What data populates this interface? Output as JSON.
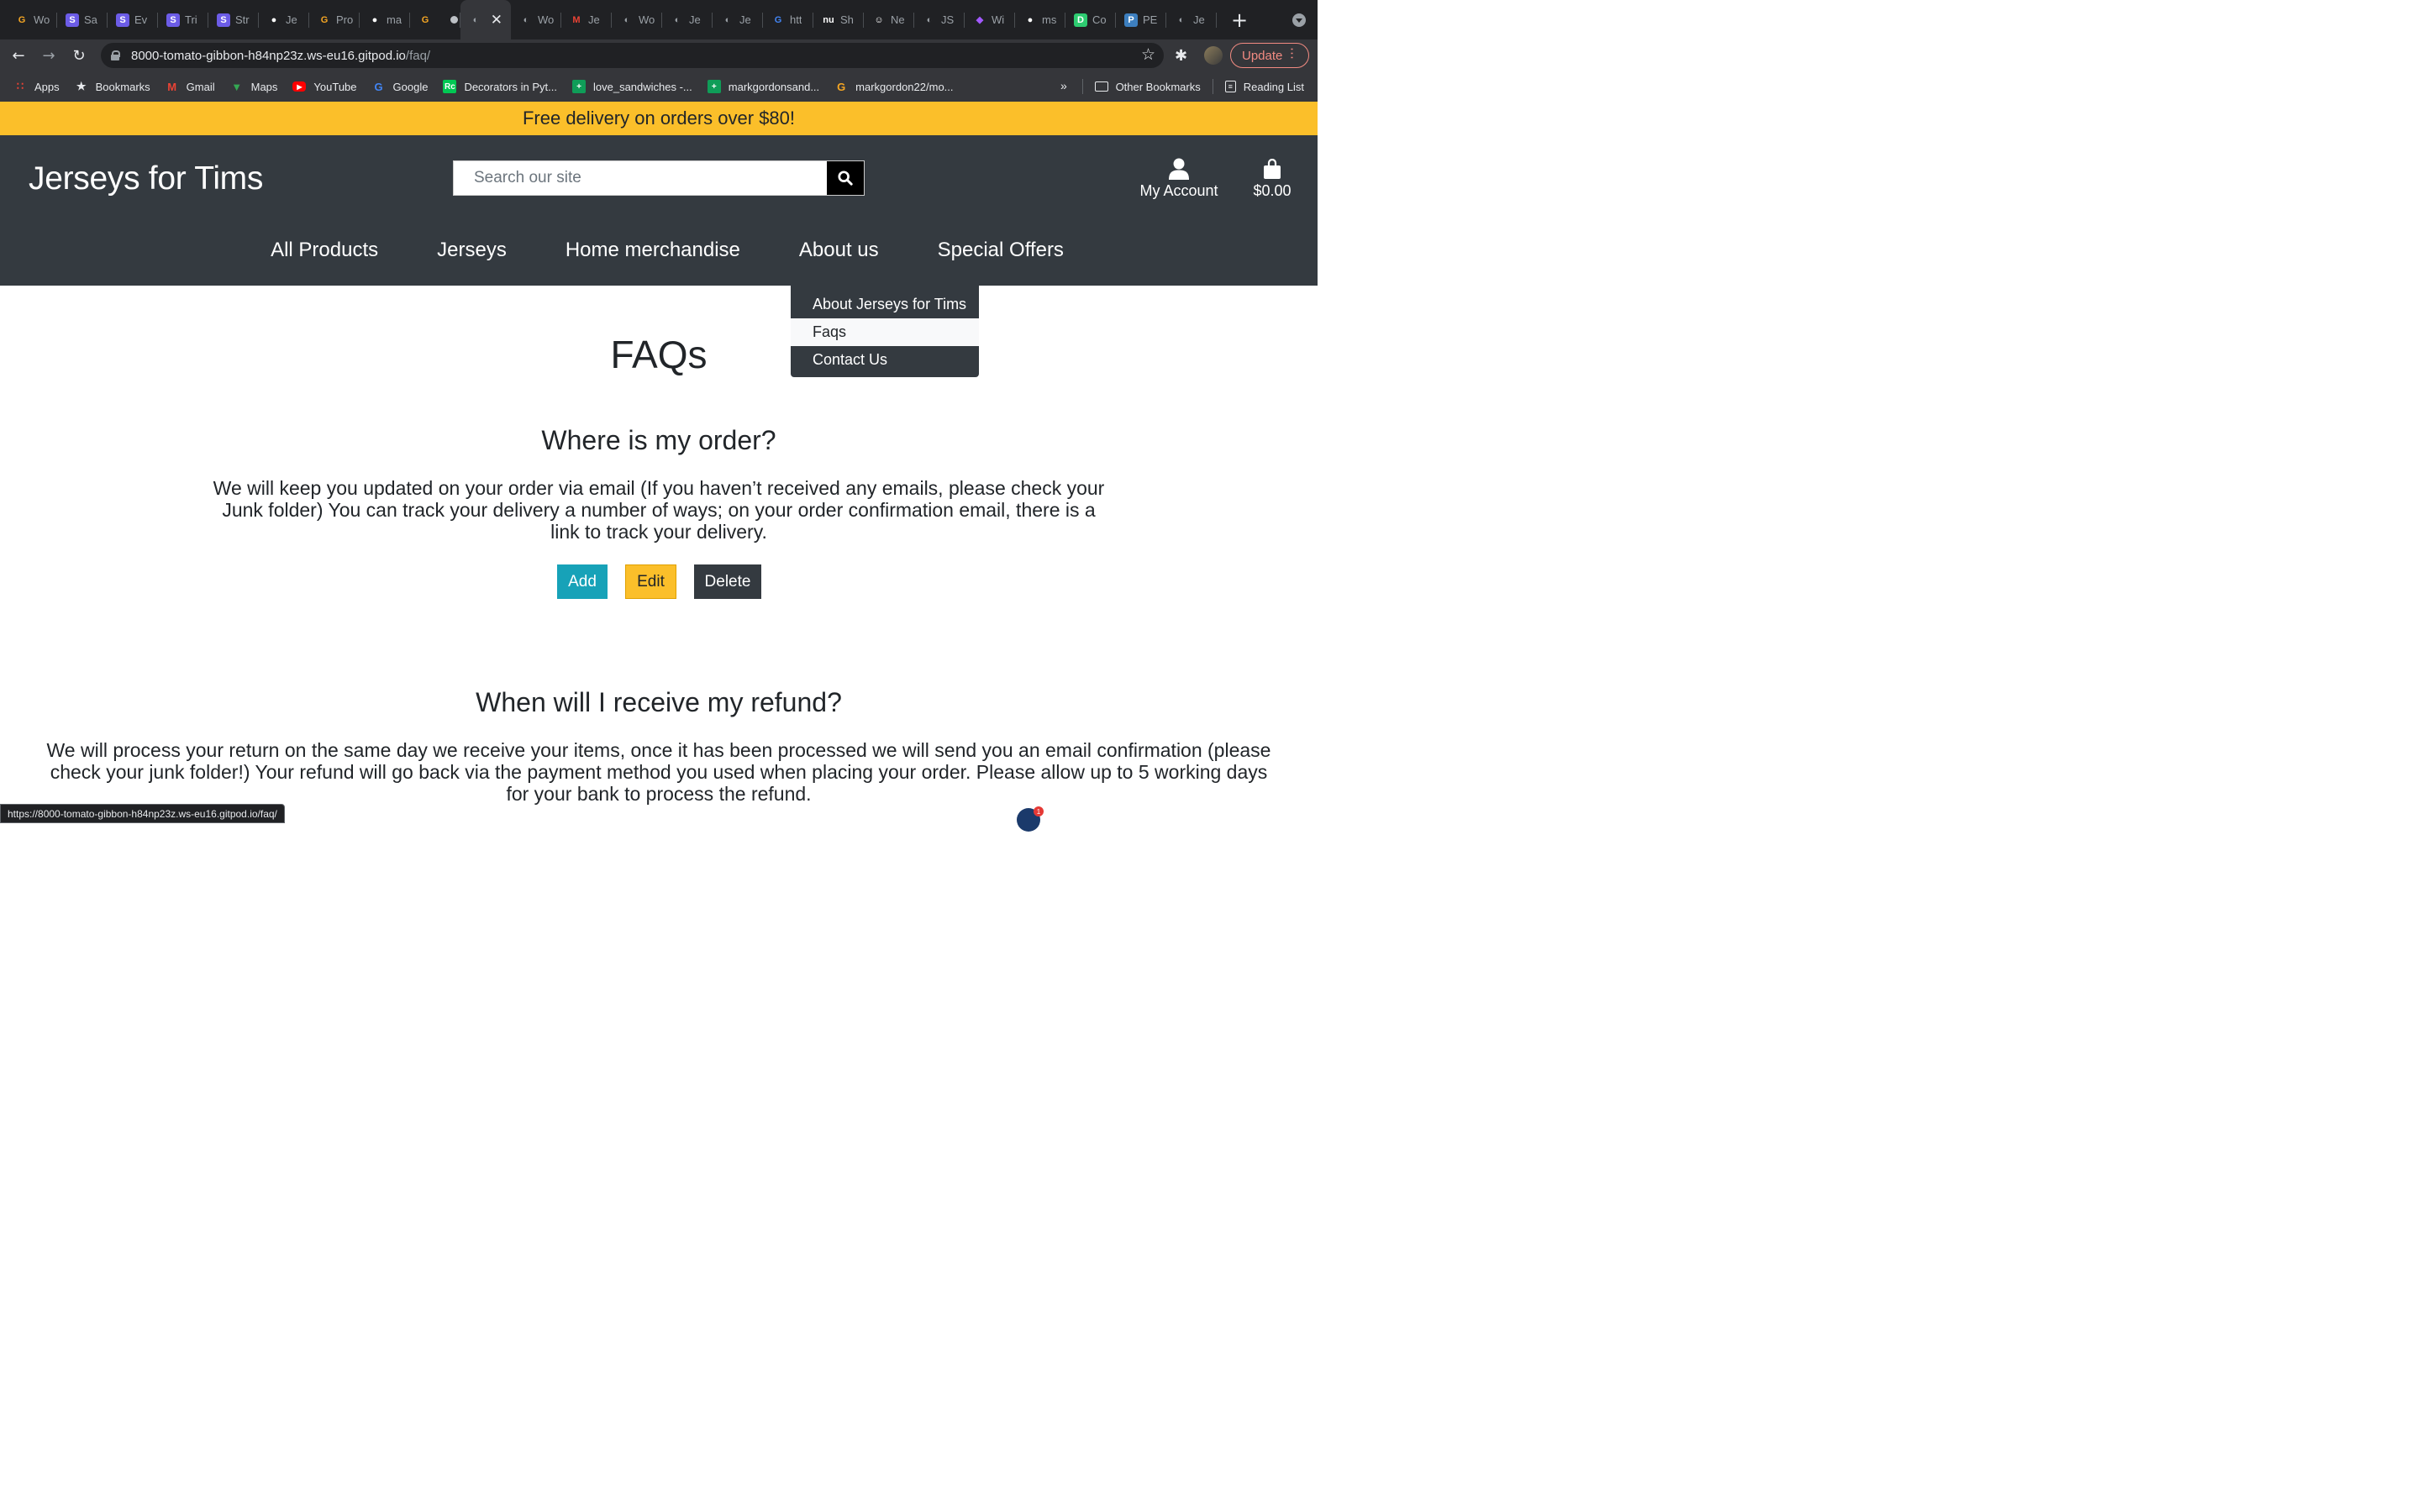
{
  "browser": {
    "tabs": [
      {
        "title": "Wo",
        "icon": "gitpod-icon",
        "color": "#f5a623"
      },
      {
        "title": "Sa",
        "icon": "s-icon",
        "color": "#6c5ce7"
      },
      {
        "title": "Ev",
        "icon": "s-icon",
        "color": "#6c5ce7"
      },
      {
        "title": "Tri",
        "icon": "s-icon",
        "color": "#6c5ce7"
      },
      {
        "title": "Str",
        "icon": "s-icon",
        "color": "#6c5ce7"
      },
      {
        "title": "Je",
        "icon": "github-icon",
        "color": "#ffffff"
      },
      {
        "title": "Pro",
        "icon": "gitpod-icon",
        "color": "#f5a623"
      },
      {
        "title": "ma",
        "icon": "github-icon",
        "color": "#ffffff"
      },
      {
        "title": "",
        "icon": "gitpod-icon",
        "color": "#f5a623"
      },
      {
        "title": "",
        "icon": "globe-icon",
        "color": "#9aa0a6"
      },
      {
        "title": "Wo",
        "icon": "globe-icon",
        "color": "#9aa0a6"
      },
      {
        "title": "Je",
        "icon": "gmail-icon",
        "color": "#ea4335"
      },
      {
        "title": "Wo",
        "icon": "globe-icon",
        "color": "#9aa0a6"
      },
      {
        "title": "Je",
        "icon": "globe-icon",
        "color": "#9aa0a6"
      },
      {
        "title": "Je",
        "icon": "globe-icon",
        "color": "#9aa0a6"
      },
      {
        "title": "htt",
        "icon": "google-icon",
        "color": "#4285f4"
      },
      {
        "title": "Sh",
        "icon": "nu-icon",
        "color": "#ffffff"
      },
      {
        "title": "Ne",
        "icon": "smiley-icon",
        "color": "#ffffff"
      },
      {
        "title": "JS",
        "icon": "globe-icon",
        "color": "#9aa0a6"
      },
      {
        "title": "Wi",
        "icon": "figma-icon",
        "color": "#a259ff"
      },
      {
        "title": "ms",
        "icon": "github-icon",
        "color": "#ffffff"
      },
      {
        "title": "Co",
        "icon": "d-icon",
        "color": "#2ecc71"
      },
      {
        "title": "PE",
        "icon": "pep-icon",
        "color": "#3d7fbf"
      },
      {
        "title": "Je",
        "icon": "globe-icon",
        "color": "#9aa0a6"
      }
    ],
    "address": {
      "host": "8000-tomato-gibbon-h84np23z.ws-eu16.gitpod.io",
      "path": "/faq/"
    },
    "update_label": "Update",
    "bookmarks": [
      {
        "label": "Apps",
        "icon": "apps-grid-icon",
        "color": "#ea4335"
      },
      {
        "label": "Bookmarks",
        "icon": "star-icon",
        "color": "#e8eaed"
      },
      {
        "label": "Gmail",
        "icon": "gmail-icon",
        "color": "#ea4335"
      },
      {
        "label": "Maps",
        "icon": "maps-pin-icon",
        "color": "#34a853"
      },
      {
        "label": "YouTube",
        "icon": "youtube-icon",
        "color": "#ff0000"
      },
      {
        "label": "Google",
        "icon": "google-icon",
        "color": "#4285f4"
      },
      {
        "label": "Decorators in Pyt...",
        "icon": "rc-icon",
        "color": "#00c853"
      },
      {
        "label": "love_sandwiches -...",
        "icon": "sheets-plus-icon",
        "color": "#0f9d58"
      },
      {
        "label": "markgordonsand...",
        "icon": "sheets-plus-icon",
        "color": "#0f9d58"
      },
      {
        "label": "markgordon22/mo...",
        "icon": "gitpod-icon",
        "color": "#f5a623"
      }
    ],
    "other_bookmarks": "Other Bookmarks",
    "reading_list": "Reading List",
    "status_url": "https://8000-tomato-gibbon-h84np23z.ws-eu16.gitpod.io/faq/"
  },
  "site": {
    "banner": "Free delivery on orders over $80!",
    "brand": "Jerseys for Tims",
    "search_placeholder": "Search our site",
    "account_label": "My Account",
    "cart_total": "$0.00",
    "nav": [
      "All Products",
      "Jerseys",
      "Home merchandise",
      "About us",
      "Special Offers"
    ],
    "about_menu": [
      "About Jerseys for Tims",
      "Faqs",
      "Contact Us"
    ]
  },
  "faq": {
    "title": "FAQs",
    "items": [
      {
        "question": "Where is my order?",
        "answer": "We will keep you updated on your order via email (If you haven’t received any emails, please check your Junk folder) You can track your delivery a number of ways; on your order confirmation email, there is a link to track your delivery."
      },
      {
        "question": "When will I receive my refund?",
        "answer": "We will process your return on the same day we receive your items, once it has been processed we will send you an email confirmation (please check your junk folder!) Your refund will go back via the payment method you used when placing your order. Please allow up to 5 working days for your bank to process the refund."
      }
    ],
    "buttons": {
      "add": "Add",
      "edit": "Edit",
      "delete": "Delete"
    }
  }
}
